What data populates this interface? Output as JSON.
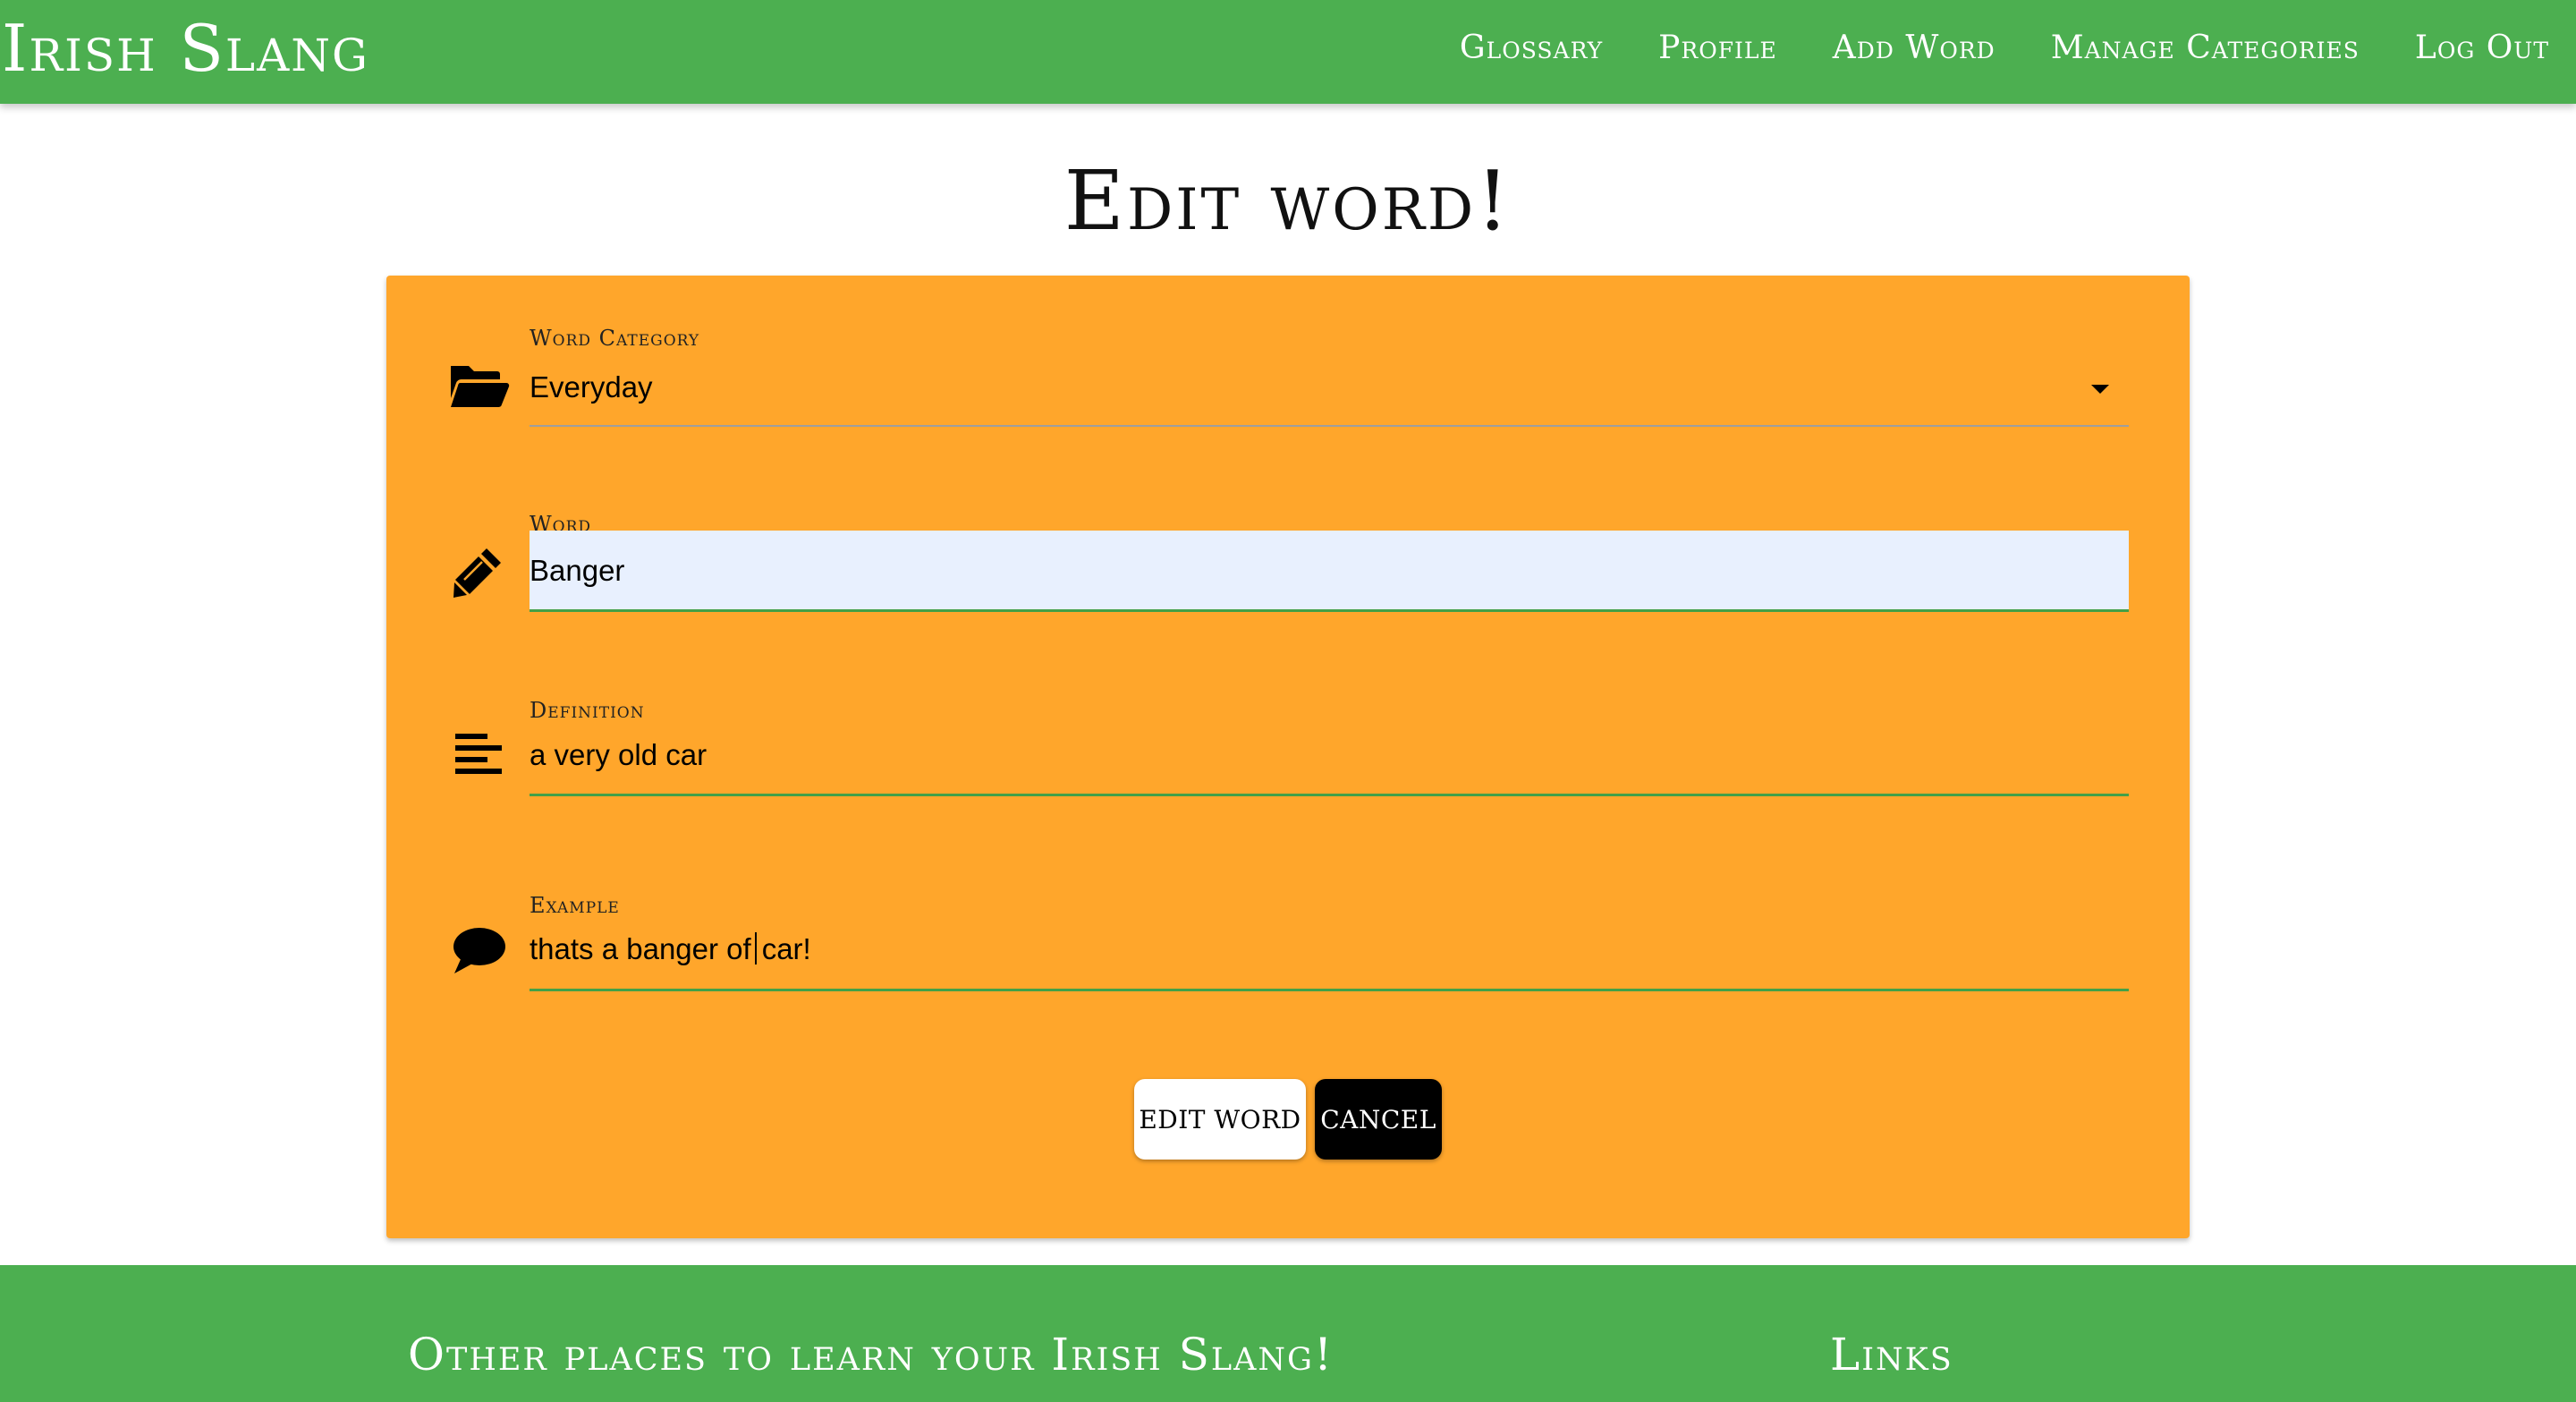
{
  "navbar": {
    "brand": "Irish Slang",
    "links": [
      "Glossary",
      "Profile",
      "Add Word",
      "Manage Categories",
      "Log Out"
    ]
  },
  "page": {
    "title": "Edit word!"
  },
  "form": {
    "category": {
      "label": "Word Category",
      "value": "Everyday",
      "icon": "folder-open-icon"
    },
    "word": {
      "label": "Word",
      "value": "Banger",
      "icon": "pencil-icon"
    },
    "definition": {
      "label": "Definition",
      "value": "a very old car",
      "icon": "align-left-icon"
    },
    "example": {
      "label": "Example",
      "value_before_cursor": "thats a banger of",
      "value_after_cursor": "car!",
      "icon": "comment-icon"
    },
    "buttons": {
      "submit": "EDIT WORD",
      "cancel": "CANCEL"
    }
  },
  "footer": {
    "left_heading": "Other places to learn your Irish Slang!",
    "right_heading": "Links"
  },
  "colors": {
    "nav_green": "#4caf50",
    "card_orange": "#ffa62b",
    "underline_green": "#43a047",
    "autofill_blue": "#e8f0fe"
  }
}
